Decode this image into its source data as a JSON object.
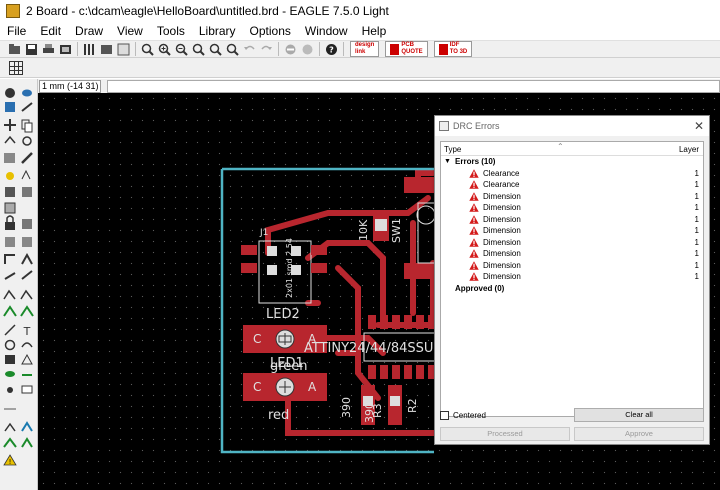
{
  "window": {
    "title": "2 Board - c:\\dcam\\eagle\\HelloBoard\\untitled.brd - EAGLE 7.5.0 Light"
  },
  "menubar": {
    "items": [
      "File",
      "Edit",
      "Draw",
      "View",
      "Tools",
      "Library",
      "Options",
      "Window",
      "Help"
    ]
  },
  "toolbar": {
    "brand_buttons": [
      {
        "name": "design-link",
        "line1": "design",
        "line2": "link"
      },
      {
        "name": "pcb-quote",
        "line1": "PCB",
        "line2": "QUOTE"
      },
      {
        "name": "idf-to-3d",
        "line1": "IDF",
        "line2": "TO 3D"
      }
    ]
  },
  "coord": {
    "value": "1 mm (-14 31)",
    "command_value": ""
  },
  "board": {
    "labels": {
      "j1": "J1",
      "jumper": "2x01 smd 2.54",
      "led2": "LED2",
      "led1": "LED1",
      "green": "green",
      "red": "red",
      "attiny": "ATTINY24/44/84SSU",
      "r10k": "10K",
      "sw1": "SW1",
      "r390a": "390",
      "r3": "R3",
      "r390b": "390",
      "r2": "R2",
      "c1": "C",
      "a1": "A",
      "c2": "C",
      "a2": "A"
    }
  },
  "drc": {
    "title": "DRC Errors",
    "columns": {
      "type": "Type",
      "layer": "Layer"
    },
    "errors_group": "Errors (10)",
    "errors": [
      {
        "type": "Clearance",
        "layer": "1"
      },
      {
        "type": "Clearance",
        "layer": "1"
      },
      {
        "type": "Dimension",
        "layer": "1"
      },
      {
        "type": "Dimension",
        "layer": "1"
      },
      {
        "type": "Dimension",
        "layer": "1"
      },
      {
        "type": "Dimension",
        "layer": "1"
      },
      {
        "type": "Dimension",
        "layer": "1"
      },
      {
        "type": "Dimension",
        "layer": "1"
      },
      {
        "type": "Dimension",
        "layer": "1"
      },
      {
        "type": "Dimension",
        "layer": "1"
      }
    ],
    "approved_group": "Approved (0)",
    "centered_label": "Centered",
    "clear_all_label": "Clear all",
    "processed_label": "Processed",
    "approve_label": "Approve"
  },
  "colors": {
    "canvas": "#000000",
    "board_outline": "#4fb4c4",
    "copper_top": "#b8262e",
    "silkscreen": "#e0e0e0",
    "error_red": "#d41a1a"
  }
}
